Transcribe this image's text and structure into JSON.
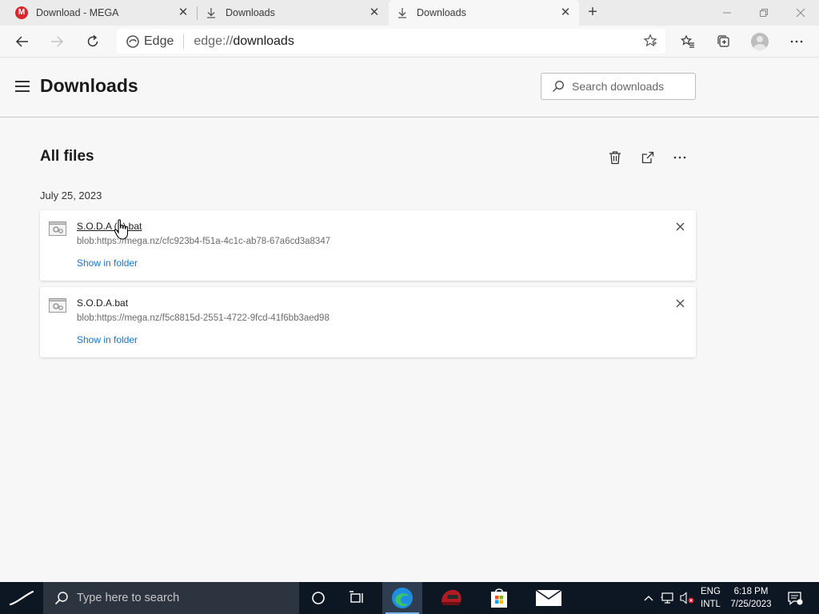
{
  "browser": {
    "tabs": [
      {
        "title": "Download - MEGA",
        "icon": "mega-logo-icon",
        "active": false
      },
      {
        "title": "Downloads",
        "icon": "download-icon",
        "active": false
      },
      {
        "title": "Downloads",
        "icon": "download-icon",
        "active": true
      }
    ],
    "mega_logo_letter": "M",
    "omnibox": {
      "site_label": "Edge",
      "url_scheme": "edge://",
      "url_path": "downloads"
    }
  },
  "page": {
    "title": "Downloads",
    "search_placeholder": "Search downloads",
    "section_title": "All files",
    "date_group": "July 25, 2023",
    "downloads": [
      {
        "file_name": "S.O.D.A (1).bat",
        "source": "blob:https://mega.nz/cfc923b4-f51a-4c1c-ab78-67a6cd3a8347",
        "action_label": "Show in folder",
        "hovered": true
      },
      {
        "file_name": "S.O.D.A.bat",
        "source": "blob:https://mega.nz/f5c8815d-2551-4722-9fcd-41f6bb3aed98",
        "action_label": "Show in folder",
        "hovered": false
      }
    ]
  },
  "taskbar": {
    "search_placeholder": "Type here to search",
    "language_line1": "ENG",
    "language_line2": "INTL",
    "time": "6:18 PM",
    "date": "7/25/2023"
  },
  "colors": {
    "link": "#1a72c7",
    "taskbar_bg": "#0d1623",
    "mega_red": "#d9272e",
    "edge_blue": "#1f8de0"
  }
}
